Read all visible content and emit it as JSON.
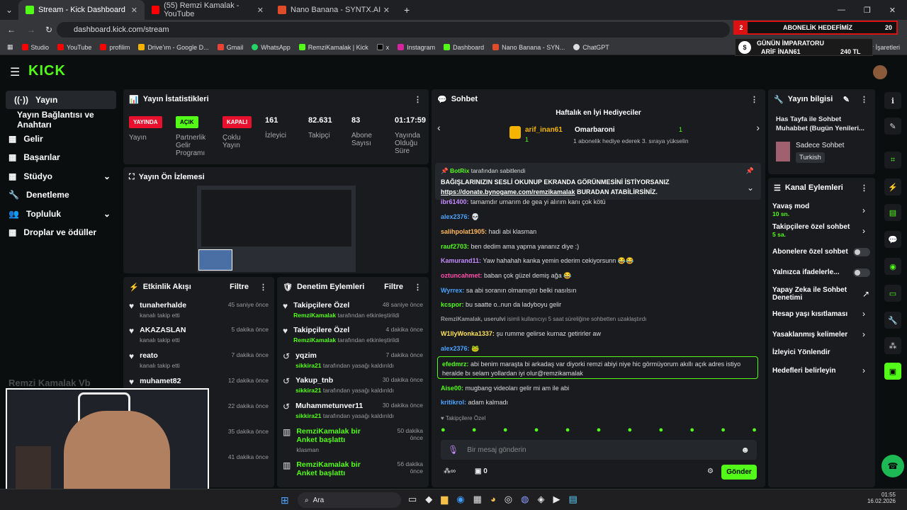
{
  "browser": {
    "tabs": [
      {
        "label": "Stream - Kick Dashboard",
        "color": "#53fc18"
      },
      {
        "label": "(55) Remzi Kamalak - YouTube",
        "color": "#ff0000"
      },
      {
        "label": "Nano Banana - SYNTX.AI",
        "color": "#e04b2a"
      }
    ],
    "url": "dashboard.kick.com/stream",
    "bookmarks": [
      "Studio",
      "YouTube",
      "profilim",
      "Drive'ım - Google D...",
      "Gmail",
      "WhatsApp",
      "RemziKamalak | Kick",
      "x",
      "Instagram",
      "Dashboard",
      "Nano Banana - SYN...",
      "ChatGPT"
    ],
    "other_bookmarks": "Yer İşaretleri"
  },
  "overlay": {
    "count": "2",
    "goal_label": "ABONELİK HEDEFİMİZ",
    "goal_value": "20",
    "emperor_title": "GÜNÜN İMPARATORU",
    "emperor_name": "ARİF İNAN61",
    "emperor_amount": "240 TL"
  },
  "sidebar": {
    "items": [
      {
        "label": "Yayın",
        "icon": "broadcast-icon"
      },
      {
        "label": "Yayın Bağlantısı ve Anahtarı",
        "icon": ""
      },
      {
        "label": "Gelir",
        "icon": "revenue-icon"
      },
      {
        "label": "Başarılar",
        "icon": "achievement-icon"
      },
      {
        "label": "Stüdyo",
        "icon": "studio-icon"
      },
      {
        "label": "Denetleme",
        "icon": "wrench-icon"
      },
      {
        "label": "Topluluk",
        "icon": "people-icon"
      },
      {
        "label": "Droplar ve ödüller",
        "icon": "gift-icon"
      }
    ]
  },
  "stats": {
    "title": "Yayın İstatistikleri",
    "items": [
      {
        "badge": "YAYINDA",
        "badge_color": "#e8112d",
        "label": "Yayın"
      },
      {
        "badge": "AÇIK",
        "badge_color": "#53fc18",
        "label": "Partnerlik Gelir Programı"
      },
      {
        "badge": "KAPALI",
        "badge_color": "#e8112d",
        "label": "Çoklu Yayın"
      },
      {
        "value": "161",
        "label": "İzleyici"
      },
      {
        "value": "82.631",
        "label": "Takipçi"
      },
      {
        "value": "83",
        "label": "Abone Sayısı"
      },
      {
        "value": "01:17:59",
        "label": "Yayında Olduğu Süre"
      }
    ]
  },
  "preview": {
    "title": "Yayın Ön İzlemesi"
  },
  "activity": {
    "title": "Etkinlik Akışı",
    "filter": "Filtre",
    "items": [
      {
        "name": "tunaherhalde",
        "desc": "kanalı takip etti",
        "time": "45 saniye önce"
      },
      {
        "name": "AKAZASLAN",
        "desc": "kanalı takip etti",
        "time": "5 dakika önce"
      },
      {
        "name": "reato",
        "desc": "kanalı takip etti",
        "time": "7 dakika önce"
      },
      {
        "name": "muhamet82",
        "desc": "",
        "time": "12 dakika önce"
      },
      {
        "name": "",
        "desc": "",
        "time": "22 dakika önce"
      },
      {
        "name": "",
        "desc": "",
        "time": "35 dakika önce"
      },
      {
        "name": "",
        "desc": "",
        "time": "41 dakika önce"
      }
    ]
  },
  "moderation": {
    "title": "Denetim Eylemleri",
    "filter": "Filtre",
    "items": [
      {
        "name": "Takipçilere Özel",
        "by": "RemziKamalak",
        "desc": "tarafından etkinleştirildi",
        "time": "48 saniye önce",
        "icon": "heart-icon"
      },
      {
        "name": "Takipçilere Özel",
        "by": "RemziKamalak",
        "desc": "tarafından etkinleştirildi",
        "time": "4 dakika önce",
        "icon": "heart-icon"
      },
      {
        "name": "yqzim",
        "by": "sikkira21",
        "desc": "tarafından yasağı kaldırıldı",
        "time": "7 dakika önce",
        "icon": "undo-icon"
      },
      {
        "name": "Yakup_tnb",
        "by": "sikkira21",
        "desc": "tarafından yasağı kaldırıldı",
        "time": "30 dakika önce",
        "icon": "undo-icon"
      },
      {
        "name": "Muhammetunver11",
        "by": "sikkira21",
        "desc": "tarafından yasağı kaldırıldı",
        "time": "30 dakika önce",
        "icon": "undo-icon"
      },
      {
        "name": "RemziKamalak bir Anket başlattı",
        "by": "",
        "desc": "klasman",
        "time": "50 dakika önce",
        "icon": "poll-icon"
      },
      {
        "name": "RemziKamalak bir Anket başlattı",
        "by": "",
        "desc": "",
        "time": "56 dakika önce",
        "icon": "poll-icon"
      }
    ]
  },
  "chat": {
    "title": "Sohbet",
    "gifters_title": "Haftalık en İyi Hediyeciler",
    "gifter1": "arif_inan61",
    "gifter1_count": "1",
    "gifter2": "Omarbaroni",
    "gifter2_count": "1",
    "gift_note": "1 abonelik hediye ederek 3. sıraya yükselin",
    "pinned_by": "BotRix",
    "pinned_by_suffix": "tarafından sabitlendi",
    "pinned_text": "BAĞIŞLARINIZIN SESLİ OKUNUP EKRANDA GÖRÜNMESİNİ İSTİYORSANIZ",
    "pinned_link": "https://donate.bynogame.com/remzikamalak",
    "pinned_tail": " BURADAN ATABİLİRSİNİZ.",
    "messages": [
      {
        "user": "ibr61400:",
        "text": "tamamdır umarım de gea yi alırım kanı çok kötü",
        "color": "#c58bff"
      },
      {
        "user": "alex2376:",
        "text": "💀",
        "color": "#4aa3ff"
      },
      {
        "user": "salihpolat1905:",
        "text": "hadi abi klasman",
        "color": "#ffb85a"
      },
      {
        "user": "rauf2703:",
        "text": "ben dedim ama yapma yananız diye :)",
        "color": "#53fc18"
      },
      {
        "user": "Kamurand11:",
        "text": "Yaw hahahah kanka yemin ederim cekiyorsunn 😂😂",
        "color": "#c58bff"
      },
      {
        "user": "oztuncahmet:",
        "text": "baban çok güzel demiş ağa 😂",
        "color": "#ff4fa8"
      },
      {
        "user": "Wyrrex:",
        "text": "sa abi soranın olmamıştır belki nasılsın",
        "color": "#4aa3ff"
      },
      {
        "user": "kcspor:",
        "text": "bu saatte o..nun da ladyboyu gelir",
        "color": "#53fc18"
      },
      {
        "user": "RemziKamalak, userulvi",
        "text": "isimli kullanıcıyı 5 saat süreliğine sohbetten uzaklaştırdı",
        "color": "#9a9a9a"
      },
      {
        "user": "W1llyWonka1337:",
        "text": "şu rumme gelirse kurnaz getirirler aw",
        "color": "#ffe35a"
      },
      {
        "user": "alex2376:",
        "text": "🐸",
        "color": "#4aa3ff"
      },
      {
        "user": "efedmrz:",
        "text": "abi benim maraşta bi arkadaş var diyorki remzi abiyi niye hic görmüyorum akıllı açık adres istiyo heralde bı selam yollardan iyi olur@remzikamalak",
        "color": "#53fc18"
      },
      {
        "user": "Aise00:",
        "text": "mugbang videoları gelir mi am ile abi",
        "color": "#53fc18"
      },
      {
        "user": "kritikrol:",
        "text": "adam kalmadı",
        "color": "#4aa3ff"
      }
    ],
    "followers_only": "Takipçilere Özel",
    "input_placeholder": "Bir mesaj gönderin",
    "points": "0",
    "send": "Gönder"
  },
  "stream_info": {
    "title": "Yayın bilgisi",
    "stream_title": "Has Tayfa ile Sohbet Muhabbet (Bugün Yenileri...",
    "category": "Sadece Sohbet",
    "language": "Turkish"
  },
  "channel_actions": {
    "title": "Kanal Eylemleri",
    "items": [
      {
        "label": "Yavaş mod",
        "sub": "10 sn.",
        "control": "chevron"
      },
      {
        "label": "Takipçilere özel sohbet",
        "sub": "5 sa.",
        "control": "chevron"
      },
      {
        "label": "Abonelere özel sohbet",
        "sub": "",
        "control": "toggle"
      },
      {
        "label": "Yalnızca ifadelerle...",
        "sub": "",
        "control": "toggle"
      },
      {
        "label": "Yapay Zeka ile Sohbet Denetimi",
        "sub": "",
        "control": "external"
      },
      {
        "label": "Hesap yaşı kısıtlaması",
        "sub": "",
        "control": "chevron"
      },
      {
        "label": "Yasaklanmış kelimeler",
        "sub": "",
        "control": "chevron"
      },
      {
        "label": "İzleyici Yönlendir",
        "sub": "",
        "control": "none"
      },
      {
        "label": "Hedefleri belirleyin",
        "sub": "",
        "control": "chevron"
      }
    ]
  },
  "taskbar": {
    "search": "Ara",
    "time": "01:55",
    "date": "16.02.2026"
  },
  "cam": {
    "name": "Remzi Kamalak Vb"
  }
}
